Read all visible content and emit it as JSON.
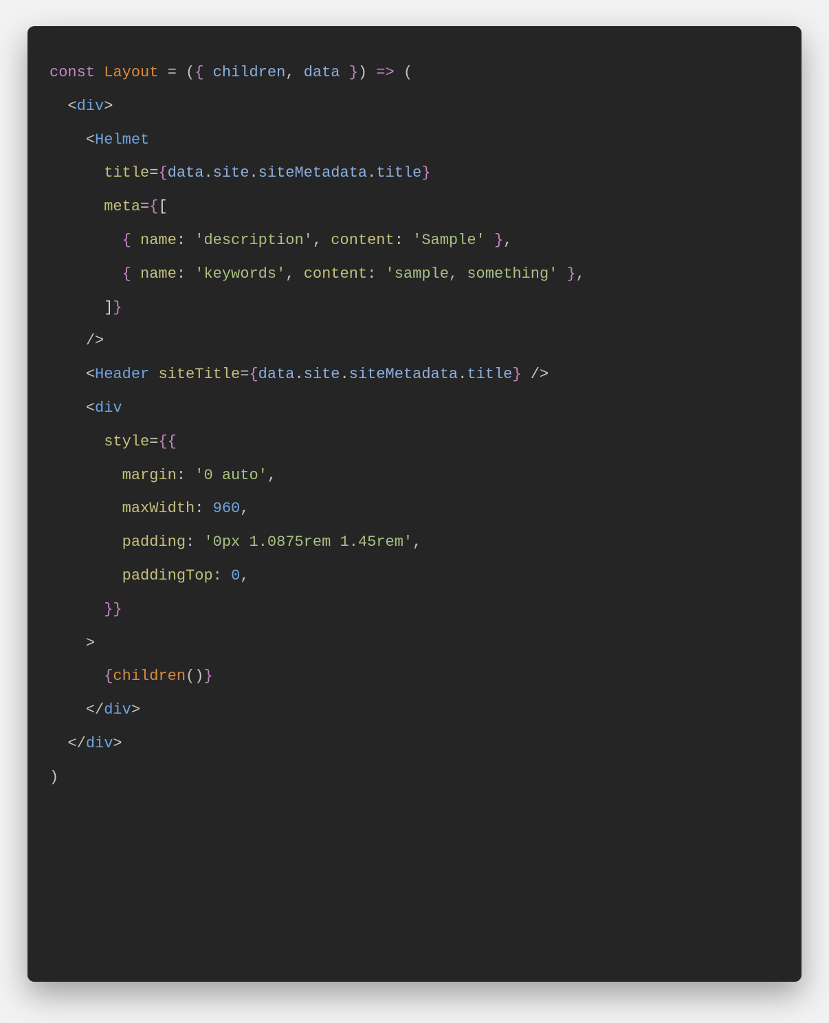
{
  "code": {
    "l1": {
      "kw": "const",
      "name": "Layout",
      "eq": " = ",
      "op1": "(",
      "br1": "{ ",
      "p1": "children",
      "comma": ", ",
      "p2": "data",
      "br2": " }",
      "op2": ")",
      "arrow": " => ",
      "op3": "("
    },
    "l2": {
      "open": "<",
      "tag": "div",
      "close": ">"
    },
    "l3": {
      "open": "<",
      "tag": "Helmet"
    },
    "l4": {
      "attr": "title",
      "eq": "=",
      "br1": "{",
      "c1": "data",
      "d": ".",
      "c2": "site",
      "c3": "siteMetadata",
      "c4": "title",
      "br2": "}"
    },
    "l5": {
      "attr": "meta",
      "eq": "=",
      "br1": "{",
      "sq1": "["
    },
    "l6": {
      "br1": "{ ",
      "k1": "name",
      "col": ": ",
      "s1": "'description'",
      "comma1": ", ",
      "k2": "content",
      "s2": "'Sample'",
      "br2": " }",
      "comma2": ","
    },
    "l7": {
      "br1": "{ ",
      "k1": "name",
      "col": ": ",
      "s1": "'keywords'",
      "comma1": ", ",
      "k2": "content",
      "s2": "'sample, something'",
      "br2": " }",
      "comma2": ","
    },
    "l8": {
      "sq2": "]",
      "br2": "}"
    },
    "l9": {
      "selfclose": "/>"
    },
    "l10": {
      "open": "<",
      "tag": "Header",
      "sp": " ",
      "attr": "siteTitle",
      "eq": "=",
      "br1": "{",
      "c1": "data",
      "d": ".",
      "c2": "site",
      "c3": "siteMetadata",
      "c4": "title",
      "br2": "}",
      "sp2": " ",
      "selfclose": "/>"
    },
    "l11": {
      "open": "<",
      "tag": "div"
    },
    "l12": {
      "attr": "style",
      "eq": "=",
      "br1": "{",
      "br2": "{"
    },
    "l13": {
      "k": "margin",
      "col": ": ",
      "s": "'0 auto'",
      "comma": ","
    },
    "l14": {
      "k": "maxWidth",
      "col": ": ",
      "n": "960",
      "comma": ","
    },
    "l15": {
      "k": "padding",
      "col": ": ",
      "s": "'0px 1.0875rem 1.45rem'",
      "comma": ","
    },
    "l16": {
      "k": "paddingTop",
      "col": ": ",
      "n": "0",
      "comma": ","
    },
    "l17": {
      "br1": "}",
      "br2": "}"
    },
    "l18": {
      "gt": ">"
    },
    "l19": {
      "br1": "{",
      "fn": "children",
      "call": "()",
      "br2": "}"
    },
    "l20": {
      "open": "</",
      "tag": "div",
      "close": ">"
    },
    "l21": {
      "open": "</",
      "tag": "div",
      "close": ">"
    },
    "l22": {
      "paren": ")"
    }
  }
}
